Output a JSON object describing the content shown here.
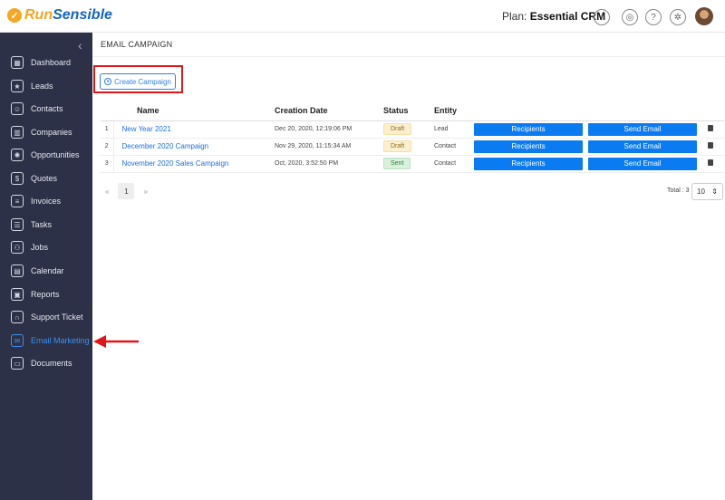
{
  "brand": {
    "run": "Run",
    "sensible": "Sensible"
  },
  "header": {
    "plan_label": "Plan:",
    "plan_name": "Essential CRM",
    "icons": [
      "upload-icon",
      "bell-icon",
      "help-icon",
      "settings-icon"
    ]
  },
  "sidebar": {
    "items": [
      {
        "label": "Dashboard",
        "icon": "dashboard-icon"
      },
      {
        "label": "Leads",
        "icon": "leads-icon"
      },
      {
        "label": "Contacts",
        "icon": "contacts-icon"
      },
      {
        "label": "Companies",
        "icon": "companies-icon"
      },
      {
        "label": "Opportunities",
        "icon": "opportunities-icon"
      },
      {
        "label": "Quotes",
        "icon": "quotes-icon"
      },
      {
        "label": "Invoices",
        "icon": "invoices-icon"
      },
      {
        "label": "Tasks",
        "icon": "tasks-icon"
      },
      {
        "label": "Jobs",
        "icon": "jobs-icon"
      },
      {
        "label": "Calendar",
        "icon": "calendar-icon"
      },
      {
        "label": "Reports",
        "icon": "reports-icon"
      },
      {
        "label": "Support Ticket",
        "icon": "support-icon"
      },
      {
        "label": "Email Marketing",
        "icon": "email-icon"
      },
      {
        "label": "Documents",
        "icon": "folder-icon"
      }
    ]
  },
  "page": {
    "breadcrumb": "EMAIL CAMPAIGN",
    "create_label": "Create Campaign"
  },
  "table": {
    "headers": {
      "name": "Name",
      "date": "Creation Date",
      "status": "Status",
      "entity": "Entity"
    },
    "rows": [
      {
        "num": "1",
        "name": "New Year 2021",
        "date": "Dec 20, 2020, 12:19:06 PM",
        "status": "Draft",
        "entity": "Lead"
      },
      {
        "num": "2",
        "name": "December 2020 Campaign",
        "date": "Nov 29, 2020, 11:15:34 AM",
        "status": "Draft",
        "entity": "Contact"
      },
      {
        "num": "3",
        "name": "November 2020 Sales Campaign",
        "date": "Oct, 2020, 3:52:50 PM",
        "status": "Sent",
        "entity": "Contact"
      }
    ],
    "recipients_label": "Recipients",
    "send_label": "Send Email"
  },
  "pagination": {
    "prev": "«",
    "page": "1",
    "next": "»",
    "total": "Total : 3",
    "page_size": "10"
  },
  "colors": {
    "accent": "#0a7bf0",
    "sidebar": "#2c3147",
    "highlight": "#e0161b"
  }
}
